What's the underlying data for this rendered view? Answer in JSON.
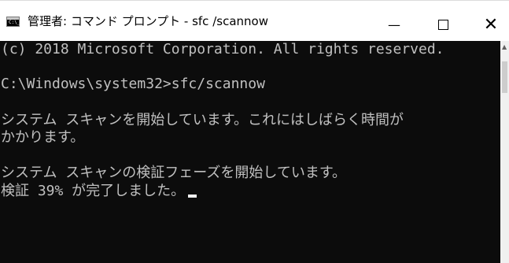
{
  "window": {
    "title": "管理者: コマンド プロンプト - sfc /scannow",
    "icon": "cmd-icon",
    "icon_text": "C:\\_",
    "controls": {
      "minimize": "—",
      "maximize": "",
      "close": "✕"
    }
  },
  "console": {
    "lines": [
      "(c) 2018 Microsoft Corporation. All rights reserved.",
      "",
      "C:\\Windows\\system32>sfc/scannow",
      "",
      "システム スキャンを開始しています。これにはしばらく時間が",
      "かかります。",
      "",
      "システム スキャンの検証フェーズを開始しています。",
      "検証 39% が完了しました。"
    ],
    "progress_percent": 39,
    "background": "#0c0c0c",
    "foreground": "#c0c0c0"
  }
}
